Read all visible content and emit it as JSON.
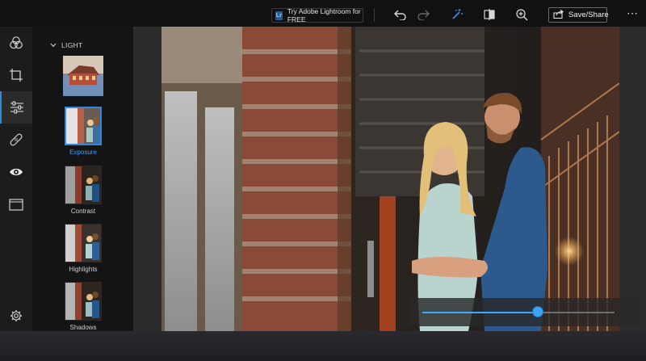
{
  "topbar": {
    "promo_label": "Try Adobe Lightroom for FREE",
    "promo_logo": "Lr",
    "save_label": "Save/Share",
    "more_label": "⋯",
    "icons": [
      "undo-icon",
      "redo-icon",
      "auto-fix-icon",
      "compare-icon",
      "zoom-icon",
      "share-icon"
    ]
  },
  "rail": {
    "items": [
      "looks-icon",
      "crop-icon",
      "adjustments-icon",
      "healing-icon",
      "red-eye-icon",
      "borders-icon"
    ],
    "active": "adjustments-icon",
    "settings": "gear-icon"
  },
  "panel": {
    "section": "LIGHT",
    "tools": [
      {
        "label": ""
      },
      {
        "label": "Exposure",
        "selected": true
      },
      {
        "label": "Contrast"
      },
      {
        "label": "Highlights"
      },
      {
        "label": "Shadows"
      }
    ]
  },
  "slider": {
    "value_fraction": 0.6,
    "accent": "#3fa9ff"
  },
  "colors": {
    "accent": "#2b8ae0",
    "background": "#222222"
  }
}
